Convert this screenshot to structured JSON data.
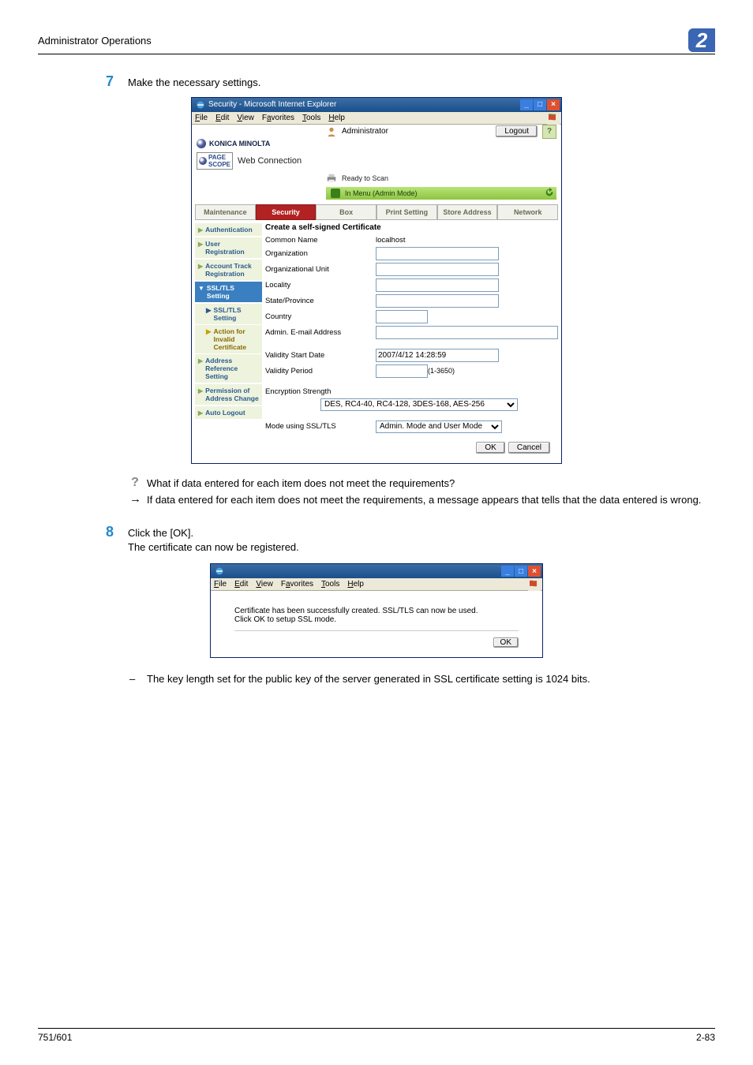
{
  "header": {
    "title": "Administrator Operations",
    "chapter": "2"
  },
  "step7": {
    "num": "7",
    "text": "Make the necessary settings."
  },
  "win1": {
    "title": "Security - Microsoft Internet Explorer",
    "menu": {
      "file": "File",
      "edit": "Edit",
      "view": "View",
      "fav": "Favorites",
      "tools": "Tools",
      "help": "Help"
    },
    "brand": "KONICA MINOLTA",
    "logout": "Logout",
    "help": "?",
    "pagescope": "PageScope",
    "webconn": "Web Connection",
    "admin": "Administrator",
    "ready": "Ready to Scan",
    "mode": "In Menu (Admin Mode)",
    "tabs": {
      "maintenance": "Maintenance",
      "security": "Security",
      "box": "Box",
      "print": "Print Setting",
      "store": "Store Address",
      "network": "Network"
    },
    "side": {
      "auth": "Authentication",
      "userreg": "User Registration",
      "acct": "Account Track Registration",
      "ssl": "SSL/TLS Setting",
      "sslsub": "SSL/TLS Setting",
      "action": "Action for Invalid Certificate",
      "addrref": "Address Reference Setting",
      "perm": "Permission of Address Change",
      "auto": "Auto Logout"
    },
    "form": {
      "heading": "Create a self-signed Certificate",
      "common": {
        "label": "Common Name",
        "value": "localhost"
      },
      "org": {
        "label": "Organization"
      },
      "orgunit": {
        "label": "Organizational Unit"
      },
      "locality": {
        "label": "Locality"
      },
      "state": {
        "label": "State/Province"
      },
      "country": {
        "label": "Country"
      },
      "email": {
        "label": "Admin. E-mail Address"
      },
      "start": {
        "label": "Validity Start Date",
        "value": "2007/4/12 14:28:59"
      },
      "period": {
        "label": "Validity Period",
        "range": "(1-3650)"
      },
      "enc": {
        "label": "Encryption Strength",
        "value": "DES, RC4-40, RC4-128, 3DES-168, AES-256"
      },
      "modeuse": {
        "label": "Mode using SSL/TLS",
        "value": "Admin. Mode and User Mode"
      },
      "ok": "OK",
      "cancel": "Cancel"
    }
  },
  "qa": {
    "q": "What if data entered for each item does not meet the requirements?",
    "a": "If data entered for each item does not meet the requirements, a message appears that tells that the data entered is wrong."
  },
  "step8": {
    "num": "8",
    "line1": "Click the [OK].",
    "line2": "The certificate can now be registered."
  },
  "win2": {
    "menu": {
      "file": "File",
      "edit": "Edit",
      "view": "View",
      "fav": "Favorites",
      "tools": "Tools",
      "help": "Help"
    },
    "msg1": "Certificate has been successfully created. SSL/TLS can now be used.",
    "msg2": "Click OK to setup SSL mode.",
    "ok": "OK"
  },
  "note": "The key length set for the public key of the server generated in SSL certificate setting is 1024 bits.",
  "footer": {
    "left": "751/601",
    "right": "2-83"
  }
}
